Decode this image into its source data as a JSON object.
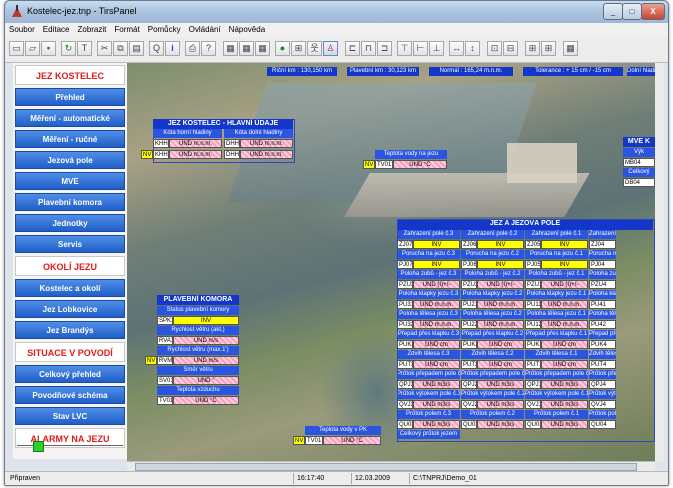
{
  "window": {
    "title": "Kostelec-jez.tnp - TirsPanel",
    "min": "_",
    "max": "□",
    "close": "X"
  },
  "menu": [
    "Soubor",
    "Editace",
    "Zobrazit",
    "Formát",
    "Pomůcky",
    "Ovládání",
    "Nápověda"
  ],
  "toolbar_icons": [
    "new-icon",
    "open-icon",
    "save-icon",
    "refresh-icon",
    "tag-icon",
    "cut-icon",
    "copy-icon",
    "paste-icon",
    "zoom-icon",
    "info-icon",
    "print-icon",
    "help-icon",
    "panel-icon",
    "panel2-icon",
    "panel3-icon",
    "scene-icon",
    "graph-icon",
    "person-icon",
    "alarm-icon",
    "align-left-icon",
    "align-center-icon",
    "align-right-icon",
    "align-top-icon",
    "align-middle-icon",
    "align-bottom-icon",
    "size-w-icon",
    "size-h-icon",
    "group-icon",
    "ungroup-icon",
    "grid-icon"
  ],
  "sidebar": {
    "sec1": "JEZ KOSTELEC",
    "items1": [
      "Přehled",
      "Měření - automatické",
      "Měření - ručné",
      "Jezová pole",
      "MVE",
      "Plavební komora",
      "Jednotky",
      "Servis"
    ],
    "sec2": "OKOLÍ JEZU",
    "items2": [
      "Kostelec a okolí",
      "Jez Lobkovice",
      "Jez Brandýs"
    ],
    "sec3": "SITUACE V POVODÍ",
    "items3": [
      "Celkový přehled",
      "Povodňové schéma",
      "Stav LVC"
    ],
    "sec4": "ALARMY NA JEZU"
  },
  "top_info": [
    "Říční km : 130,150 km",
    "Plavební km : 30,123 km",
    "Normál : 165,24 m.n.m.",
    "Tolerance : + 15 cm / -15 cm",
    "Dolní hladina"
  ],
  "hlavni": {
    "title": "JEZ KOSTELEC - HLAVNÍ ÚDAJE",
    "col1": "Kóta horní hladiny",
    "col2": "Kóta dolní hladiny",
    "row1": [
      "KHH1",
      "UND m.n.m.",
      "DHH1",
      "UND m.n.m."
    ],
    "row2": [
      "NV",
      "KHH1",
      "UND m.n.m.",
      "DHH1",
      "UND m.n.m."
    ]
  },
  "teplota_jez": {
    "title": "Teplota vody na jezu",
    "nv": "NV",
    "tag": "TV01",
    "val": "UND °C"
  },
  "mve": {
    "title": "MVE K",
    "l1": "Výk",
    "tag1": "MB04",
    "l2": "Celkový",
    "tag2": "DB04"
  },
  "plavebni": {
    "title": "PLAVEBNÍ KOMORA",
    "l1": "Status plavební komory",
    "t1": "SPK1",
    "v1": "INV",
    "l2": "Rychlost větru (akt.)",
    "t2": "RVA1",
    "v2": "UND m/s",
    "l3": "Rychlost větru (max.1')",
    "nv": "NV",
    "t3": "RVM1",
    "v3": "UND m/s",
    "l4": "Směr větru",
    "t4": "SV01",
    "v4": "UND °",
    "l5": "Teplota vzduchu",
    "t5": "TV01",
    "v5": "UND °C"
  },
  "teplota_pk": {
    "title": "Teplota vody v PK",
    "nv": "NV",
    "tag": "TV01",
    "val": "UND °C"
  },
  "jezova": {
    "title": "JEZ A JEZOVÁ POLE",
    "pole": [
      "Zahrazení pole č.3",
      "Zahrazení pole č.2",
      "Zahrazení pole č.1",
      "Zahrazení pole"
    ],
    "r1": [
      "ZJ07",
      "INV",
      "ZJ06",
      "INV",
      "ZJ05",
      "INV",
      "ZJ04"
    ],
    "poruchy": [
      "Porucha na jezu č.3",
      "Porucha na jezu č.2",
      "Porucha na jezu č.1",
      "Porucha na jezu"
    ],
    "r2": [
      "PJ07",
      "INV",
      "PJ06",
      "INV",
      "PJ05",
      "INV",
      "PJ04"
    ],
    "polohy": [
      "Poloha zubů - jez č.3",
      "Poloha zubů - jez č.2",
      "Poloha zubů - jez č.1",
      "Poloha zu"
    ],
    "r3": [
      "PZU3",
      "UND (I)+/-",
      "PZU2",
      "UND (I)+/-",
      "PZU1",
      "UND (I)+/-",
      "PZU4"
    ],
    "klapky": [
      "Poloha klapky jezu č.3",
      "Poloha klapky jezu č.2",
      "Poloha klapky jezu č.1",
      "Poloha klapk"
    ],
    "r4": [
      "PU31",
      "UND m.n.m.",
      "PU21",
      "UND m.n.m.",
      "PU11",
      "UND m.n.m.",
      "PU41"
    ],
    "telesa": [
      "Poloha tělesa jezu č.3",
      "Poloha tělesa jezu č.2",
      "Poloha tělesa jezu č.1",
      "Poloha těles"
    ],
    "r5": [
      "PU32",
      "UND m.n.m.",
      "PU22",
      "UND m.n.m.",
      "PU12",
      "UND m.n.m.",
      "PU42"
    ],
    "prepady": [
      "Přepad přes klapku č.3",
      "Přepad přes klapku č.2",
      "Přepad přes klapku č.1",
      "Přepad přes"
    ],
    "r6": [
      "PUK3",
      "UND cm",
      "PUK2",
      "UND cm",
      "PUK1",
      "UND cm",
      "PUK4"
    ],
    "zdvihy": [
      "Zdvih tělesa č.3",
      "Zdvih tělesa č.2",
      "Zdvih tělesa č.1",
      "Zdvih těles"
    ],
    "r7": [
      "PUT3",
      "UND cm",
      "PUT2",
      "UND cm",
      "PUT1",
      "UND cm",
      "PUT4"
    ],
    "prutokp": [
      "Průtok přepadem pole č.3",
      "Průtok přepadem pole č.2",
      "Průtok přepadem pole č.1",
      "Průtok přep"
    ],
    "r8": [
      "QPJ3",
      "UND m3/s",
      "QPJ2",
      "UND m3/s",
      "QPJ1",
      "UND m3/s",
      "QPJ4"
    ],
    "prutokv": [
      "Průtok výtokem pole č.3",
      "Průtok výtokem pole č.2",
      "Průtok výtokem pole č.1",
      "Průtok výto"
    ],
    "r9": [
      "QVJ3",
      "UND m3/s",
      "QVJ2",
      "UND m3/s",
      "QVJ1",
      "UND m3/s",
      "QVJ4"
    ],
    "prutokc": [
      "Průtok polem č.3",
      "Průtok polem č.2",
      "Průtok polem č.1",
      "Průtok pol"
    ],
    "r10": [
      "QU03",
      "UND m3/s",
      "QU02",
      "UND m3/s",
      "QU01",
      "UND m3/s",
      "QU04"
    ],
    "celkovy": "Celkový průtok jezem"
  },
  "status": {
    "left": "Připraven",
    "time": "16:17:40",
    "date": "12.03.2009",
    "path": "C:\\TNPRJ\\Demo_01"
  }
}
